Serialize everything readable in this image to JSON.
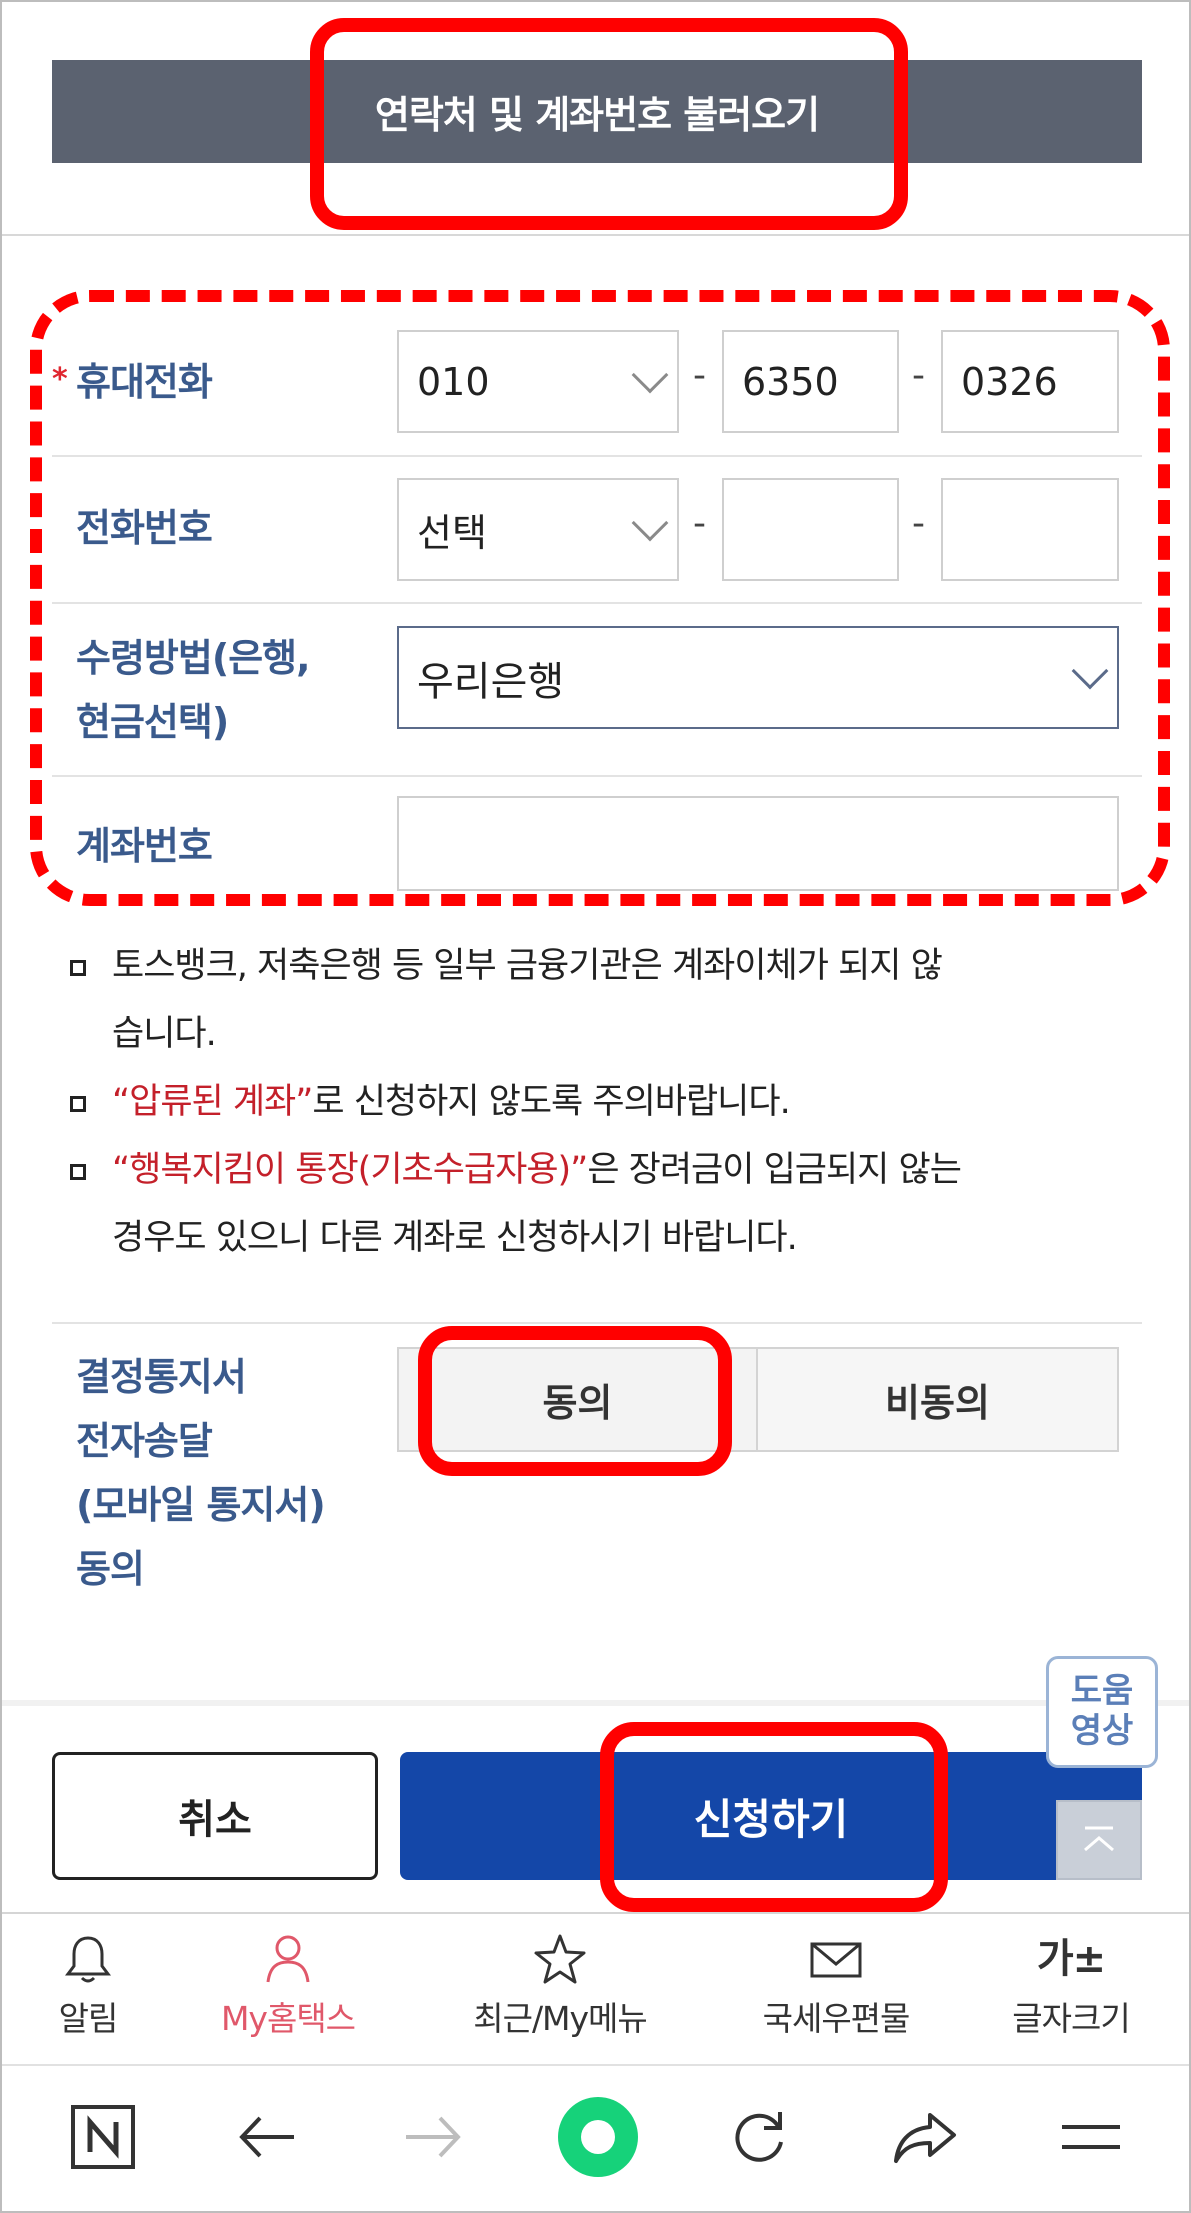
{
  "load_button": {
    "label": "연락처 및 계좌번호 불러오기"
  },
  "form": {
    "required_mark": "*",
    "mobile": {
      "label": "휴대전화",
      "prefix": "010",
      "mid": "6350",
      "last": "0326",
      "separator": "-"
    },
    "phone": {
      "label": "전화번호",
      "prefix": "선택",
      "mid": "",
      "last": "",
      "separator": "-"
    },
    "receipt_method": {
      "label_line1": "수령방법(은행,",
      "label_line2": "현금선택)",
      "value": "우리은행"
    },
    "account": {
      "label": "계좌번호",
      "value": ""
    }
  },
  "notices": {
    "n1_line1": "토스뱅크, 저축은행 등 일부 금융기관은 계좌이체가 되지 않",
    "n1_line2": "습니다.",
    "n2_red": "“압류된 계좌”",
    "n2_rest": "로 신청하지 않도록 주의바랍니다.",
    "n3_red": "“행복지킴이 통장(기초수급자용)”",
    "n3_rest": "은 장려금이 입금되지 않는",
    "n3_line2": "경우도 있으니 다른 계좌로 신청하시기 바랍니다."
  },
  "consent": {
    "label_line1": "결정통지서",
    "label_line2": "전자송달",
    "label_line3": "(모바일 통지서)",
    "label_line4": "동의",
    "agree": "동의",
    "disagree": "비동의"
  },
  "actions": {
    "cancel": "취소",
    "apply": "신청하기",
    "help_line1": "도움",
    "help_line2": "영상"
  },
  "tabbar": {
    "items": [
      {
        "label": "알림",
        "icon": "bell-icon"
      },
      {
        "label": "My홈택스",
        "icon": "person-icon",
        "active": true
      },
      {
        "label": "최근/My메뉴",
        "icon": "star-icon"
      },
      {
        "label": "국세우편물",
        "icon": "mail-icon"
      },
      {
        "label": "글자크기",
        "icon": "font-size-icon",
        "glyph": "가±"
      }
    ]
  },
  "colors": {
    "accent": "#1447a8",
    "annotation": "#ff0000",
    "label": "#3a5a8c",
    "active_tab": "#e0586a",
    "warning": "#c4202a"
  }
}
